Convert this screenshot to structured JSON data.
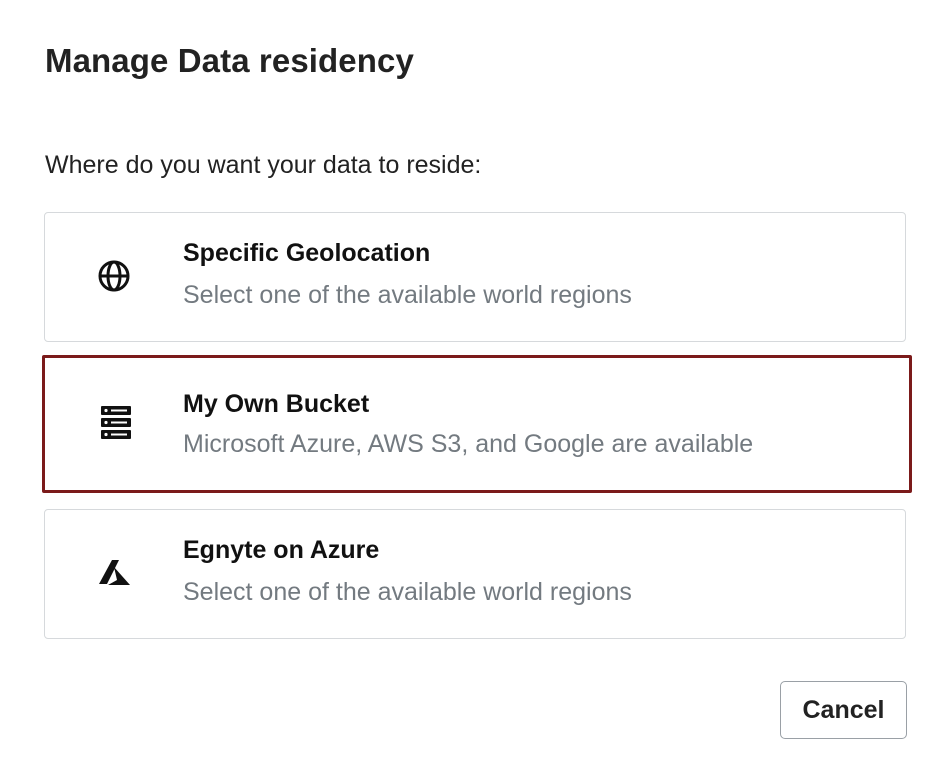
{
  "dialog": {
    "title": "Manage Data residency",
    "prompt": "Where do you want your data to reside:",
    "options": [
      {
        "icon": "globe-icon",
        "label": "Specific Geolocation",
        "description": "Select one of the available world regions",
        "selected": false
      },
      {
        "icon": "server-icon",
        "label": "My Own Bucket",
        "description": "Microsoft Azure, AWS S3, and Google are available",
        "selected": true
      },
      {
        "icon": "azure-icon",
        "label": "Egnyte on Azure",
        "description": "Select one of the available world regions",
        "selected": false
      }
    ],
    "cancel_label": "Cancel"
  },
  "colors": {
    "selected_border": "#7b1a1a",
    "card_border": "#d6d9dc",
    "description_text": "#737a80"
  }
}
